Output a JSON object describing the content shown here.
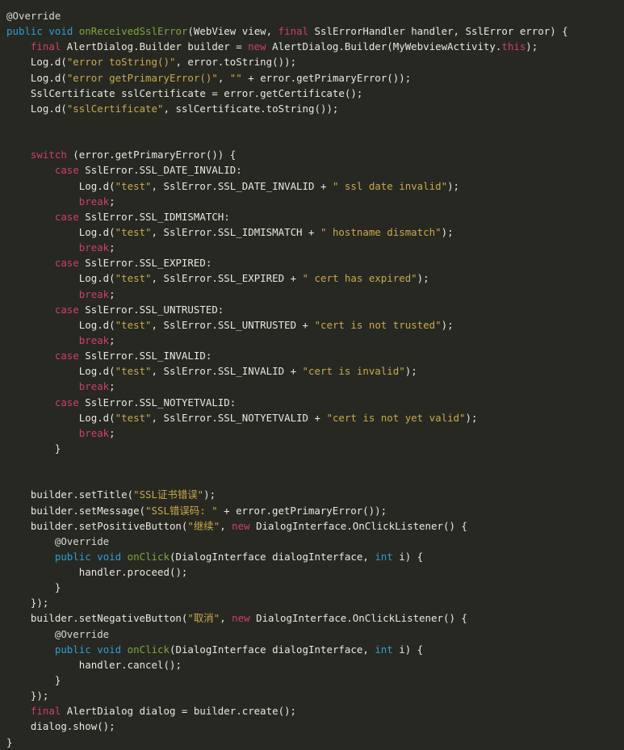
{
  "editor": {
    "name": "java-code-viewer",
    "language": "Java",
    "theme": "dark-monokai",
    "background_color": "#272822",
    "colors": {
      "plain": "#e8e8e0",
      "keyword_blue": "#2b9ed4",
      "keyword_pink": "#cf3f69",
      "method_green": "#7fa63f",
      "string_gold": "#c9a94a",
      "annotation": "#d8d8d0"
    },
    "total_lines": 46
  },
  "lines": [
    {
      "n": 1,
      "indent": 0,
      "tokens": [
        {
          "t": "anno",
          "v": "@Override"
        }
      ]
    },
    {
      "n": 2,
      "indent": 0,
      "tokens": [
        {
          "t": "kw",
          "v": "public"
        },
        {
          "t": "plain",
          "v": " "
        },
        {
          "t": "kw",
          "v": "void"
        },
        {
          "t": "plain",
          "v": " "
        },
        {
          "t": "fn",
          "v": "onReceivedSslError"
        },
        {
          "t": "plain",
          "v": "(WebView view, "
        },
        {
          "t": "kw2",
          "v": "final"
        },
        {
          "t": "plain",
          "v": " SslErrorHandler handler, SslError error) {"
        }
      ]
    },
    {
      "n": 3,
      "indent": 1,
      "tokens": [
        {
          "t": "kw2",
          "v": "final"
        },
        {
          "t": "plain",
          "v": " AlertDialog.Builder builder = "
        },
        {
          "t": "kw2",
          "v": "new"
        },
        {
          "t": "plain",
          "v": " AlertDialog.Builder(MyWebviewActivity."
        },
        {
          "t": "kw2",
          "v": "this"
        },
        {
          "t": "plain",
          "v": ");"
        }
      ]
    },
    {
      "n": 4,
      "indent": 1,
      "tokens": [
        {
          "t": "plain",
          "v": "Log.d("
        },
        {
          "t": "str",
          "v": "\"error toString()\""
        },
        {
          "t": "plain",
          "v": ", error.toString());"
        }
      ]
    },
    {
      "n": 5,
      "indent": 1,
      "tokens": [
        {
          "t": "plain",
          "v": "Log.d("
        },
        {
          "t": "str",
          "v": "\"error getPrimaryError()\""
        },
        {
          "t": "plain",
          "v": ", "
        },
        {
          "t": "str",
          "v": "\"\""
        },
        {
          "t": "plain",
          "v": " + error.getPrimaryError());"
        }
      ]
    },
    {
      "n": 6,
      "indent": 1,
      "tokens": [
        {
          "t": "plain",
          "v": "SslCertificate sslCertificate = error.getCertificate();"
        }
      ]
    },
    {
      "n": 7,
      "indent": 1,
      "tokens": [
        {
          "t": "plain",
          "v": "Log.d("
        },
        {
          "t": "str",
          "v": "\"sslCertificate\""
        },
        {
          "t": "plain",
          "v": ", sslCertificate.toString());"
        }
      ]
    },
    {
      "n": 8,
      "indent": 0,
      "tokens": []
    },
    {
      "n": 9,
      "indent": 0,
      "tokens": []
    },
    {
      "n": 10,
      "indent": 1,
      "tokens": [
        {
          "t": "kw2",
          "v": "switch"
        },
        {
          "t": "plain",
          "v": " (error.getPrimaryError()) {"
        }
      ]
    },
    {
      "n": 11,
      "indent": 2,
      "tokens": [
        {
          "t": "kw2",
          "v": "case"
        },
        {
          "t": "plain",
          "v": " SslError.SSL_DATE_INVALID:"
        }
      ]
    },
    {
      "n": 12,
      "indent": 3,
      "tokens": [
        {
          "t": "plain",
          "v": "Log.d("
        },
        {
          "t": "str",
          "v": "\"test\""
        },
        {
          "t": "plain",
          "v": ", SslError.SSL_DATE_INVALID + "
        },
        {
          "t": "str",
          "v": "\" ssl date invalid\""
        },
        {
          "t": "plain",
          "v": ");"
        }
      ]
    },
    {
      "n": 13,
      "indent": 3,
      "tokens": [
        {
          "t": "kw2",
          "v": "break"
        },
        {
          "t": "plain",
          "v": ";"
        }
      ]
    },
    {
      "n": 14,
      "indent": 2,
      "tokens": [
        {
          "t": "kw2",
          "v": "case"
        },
        {
          "t": "plain",
          "v": " SslError.SSL_IDMISMATCH:"
        }
      ]
    },
    {
      "n": 15,
      "indent": 3,
      "tokens": [
        {
          "t": "plain",
          "v": "Log.d("
        },
        {
          "t": "str",
          "v": "\"test\""
        },
        {
          "t": "plain",
          "v": ", SslError.SSL_IDMISMATCH + "
        },
        {
          "t": "str",
          "v": "\" hostname dismatch\""
        },
        {
          "t": "plain",
          "v": ");"
        }
      ]
    },
    {
      "n": 16,
      "indent": 3,
      "tokens": [
        {
          "t": "kw2",
          "v": "break"
        },
        {
          "t": "plain",
          "v": ";"
        }
      ]
    },
    {
      "n": 17,
      "indent": 2,
      "tokens": [
        {
          "t": "kw2",
          "v": "case"
        },
        {
          "t": "plain",
          "v": " SslError.SSL_EXPIRED:"
        }
      ]
    },
    {
      "n": 18,
      "indent": 3,
      "tokens": [
        {
          "t": "plain",
          "v": "Log.d("
        },
        {
          "t": "str",
          "v": "\"test\""
        },
        {
          "t": "plain",
          "v": ", SslError.SSL_EXPIRED + "
        },
        {
          "t": "str",
          "v": "\" cert has expired\""
        },
        {
          "t": "plain",
          "v": ");"
        }
      ]
    },
    {
      "n": 19,
      "indent": 3,
      "tokens": [
        {
          "t": "kw2",
          "v": "break"
        },
        {
          "t": "plain",
          "v": ";"
        }
      ]
    },
    {
      "n": 20,
      "indent": 2,
      "tokens": [
        {
          "t": "kw2",
          "v": "case"
        },
        {
          "t": "plain",
          "v": " SslError.SSL_UNTRUSTED:"
        }
      ]
    },
    {
      "n": 21,
      "indent": 3,
      "tokens": [
        {
          "t": "plain",
          "v": "Log.d("
        },
        {
          "t": "str",
          "v": "\"test\""
        },
        {
          "t": "plain",
          "v": ", SslError.SSL_UNTRUSTED + "
        },
        {
          "t": "str",
          "v": "\"cert is not trusted\""
        },
        {
          "t": "plain",
          "v": ");"
        }
      ]
    },
    {
      "n": 22,
      "indent": 3,
      "tokens": [
        {
          "t": "kw2",
          "v": "break"
        },
        {
          "t": "plain",
          "v": ";"
        }
      ]
    },
    {
      "n": 23,
      "indent": 2,
      "tokens": [
        {
          "t": "kw2",
          "v": "case"
        },
        {
          "t": "plain",
          "v": " SslError.SSL_INVALID:"
        }
      ]
    },
    {
      "n": 24,
      "indent": 3,
      "tokens": [
        {
          "t": "plain",
          "v": "Log.d("
        },
        {
          "t": "str",
          "v": "\"test\""
        },
        {
          "t": "plain",
          "v": ", SslError.SSL_INVALID + "
        },
        {
          "t": "str",
          "v": "\"cert is invalid\""
        },
        {
          "t": "plain",
          "v": ");"
        }
      ]
    },
    {
      "n": 25,
      "indent": 3,
      "tokens": [
        {
          "t": "kw2",
          "v": "break"
        },
        {
          "t": "plain",
          "v": ";"
        }
      ]
    },
    {
      "n": 26,
      "indent": 2,
      "tokens": [
        {
          "t": "kw2",
          "v": "case"
        },
        {
          "t": "plain",
          "v": " SslError.SSL_NOTYETVALID:"
        }
      ]
    },
    {
      "n": 27,
      "indent": 3,
      "tokens": [
        {
          "t": "plain",
          "v": "Log.d("
        },
        {
          "t": "str",
          "v": "\"test\""
        },
        {
          "t": "plain",
          "v": ", SslError.SSL_NOTYETVALID + "
        },
        {
          "t": "str",
          "v": "\"cert is not yet valid\""
        },
        {
          "t": "plain",
          "v": ");"
        }
      ]
    },
    {
      "n": 28,
      "indent": 3,
      "tokens": [
        {
          "t": "kw2",
          "v": "break"
        },
        {
          "t": "plain",
          "v": ";"
        }
      ]
    },
    {
      "n": 29,
      "indent": 2,
      "tokens": [
        {
          "t": "plain",
          "v": "}"
        }
      ]
    },
    {
      "n": 30,
      "indent": 0,
      "tokens": []
    },
    {
      "n": 31,
      "indent": 0,
      "tokens": []
    },
    {
      "n": 32,
      "indent": 1,
      "tokens": [
        {
          "t": "plain",
          "v": "builder.setTitle("
        },
        {
          "t": "str",
          "v": "\"SSL证书错误\""
        },
        {
          "t": "plain",
          "v": ");"
        }
      ]
    },
    {
      "n": 33,
      "indent": 1,
      "tokens": [
        {
          "t": "plain",
          "v": "builder.setMessage("
        },
        {
          "t": "str",
          "v": "\"SSL错误码: \""
        },
        {
          "t": "plain",
          "v": " + error.getPrimaryError());"
        }
      ]
    },
    {
      "n": 34,
      "indent": 1,
      "tokens": [
        {
          "t": "plain",
          "v": "builder.setPositiveButton("
        },
        {
          "t": "str",
          "v": "\"继续\""
        },
        {
          "t": "plain",
          "v": ", "
        },
        {
          "t": "kw2",
          "v": "new"
        },
        {
          "t": "plain",
          "v": " DialogInterface.OnClickListener() {"
        }
      ]
    },
    {
      "n": 35,
      "indent": 2,
      "tokens": [
        {
          "t": "anno",
          "v": "@Override"
        }
      ]
    },
    {
      "n": 36,
      "indent": 2,
      "tokens": [
        {
          "t": "kw",
          "v": "public"
        },
        {
          "t": "plain",
          "v": " "
        },
        {
          "t": "kw",
          "v": "void"
        },
        {
          "t": "plain",
          "v": " "
        },
        {
          "t": "fn",
          "v": "onClick"
        },
        {
          "t": "plain",
          "v": "(DialogInterface dialogInterface, "
        },
        {
          "t": "kw",
          "v": "int"
        },
        {
          "t": "plain",
          "v": " i) {"
        }
      ]
    },
    {
      "n": 37,
      "indent": 3,
      "tokens": [
        {
          "t": "plain",
          "v": "handler.proceed();"
        }
      ]
    },
    {
      "n": 38,
      "indent": 2,
      "tokens": [
        {
          "t": "plain",
          "v": "}"
        }
      ]
    },
    {
      "n": 39,
      "indent": 1,
      "tokens": [
        {
          "t": "plain",
          "v": "});"
        }
      ]
    },
    {
      "n": 40,
      "indent": 1,
      "tokens": [
        {
          "t": "plain",
          "v": "builder.setNegativeButton("
        },
        {
          "t": "str",
          "v": "\"取消\""
        },
        {
          "t": "plain",
          "v": ", "
        },
        {
          "t": "kw2",
          "v": "new"
        },
        {
          "t": "plain",
          "v": " DialogInterface.OnClickListener() {"
        }
      ]
    },
    {
      "n": 41,
      "indent": 2,
      "tokens": [
        {
          "t": "anno",
          "v": "@Override"
        }
      ]
    },
    {
      "n": 42,
      "indent": 2,
      "tokens": [
        {
          "t": "kw",
          "v": "public"
        },
        {
          "t": "plain",
          "v": " "
        },
        {
          "t": "kw",
          "v": "void"
        },
        {
          "t": "plain",
          "v": " "
        },
        {
          "t": "fn",
          "v": "onClick"
        },
        {
          "t": "plain",
          "v": "(DialogInterface dialogInterface, "
        },
        {
          "t": "kw",
          "v": "int"
        },
        {
          "t": "plain",
          "v": " i) {"
        }
      ]
    },
    {
      "n": 43,
      "indent": 3,
      "tokens": [
        {
          "t": "plain",
          "v": "handler.cancel();"
        }
      ]
    },
    {
      "n": 44,
      "indent": 2,
      "tokens": [
        {
          "t": "plain",
          "v": "}"
        }
      ]
    },
    {
      "n": 45,
      "indent": 1,
      "tokens": [
        {
          "t": "plain",
          "v": "});"
        }
      ]
    },
    {
      "n": 46,
      "indent": 1,
      "tokens": [
        {
          "t": "kw2",
          "v": "final"
        },
        {
          "t": "plain",
          "v": " AlertDialog dialog = builder.create();"
        }
      ]
    },
    {
      "n": 47,
      "indent": 1,
      "tokens": [
        {
          "t": "plain",
          "v": "dialog.show();"
        }
      ]
    },
    {
      "n": 48,
      "indent": 0,
      "tokens": [
        {
          "t": "plain",
          "v": "}"
        }
      ]
    }
  ]
}
